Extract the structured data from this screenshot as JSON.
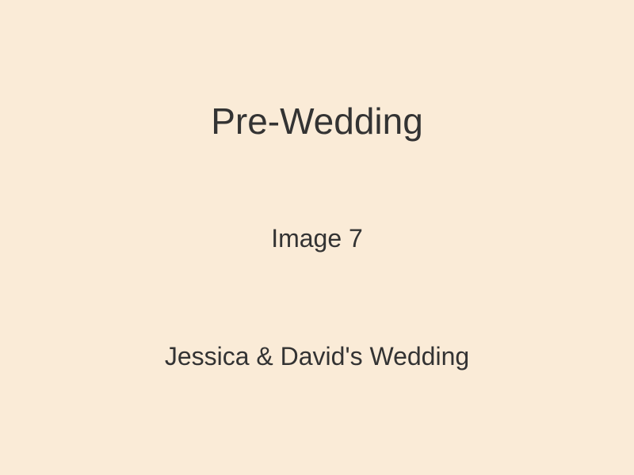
{
  "background_color": "#FAEBD7",
  "text_color": "#333333",
  "title": "Pre-Wedding",
  "image_label": "Image 7",
  "caption": "Jessica & David's Wedding"
}
